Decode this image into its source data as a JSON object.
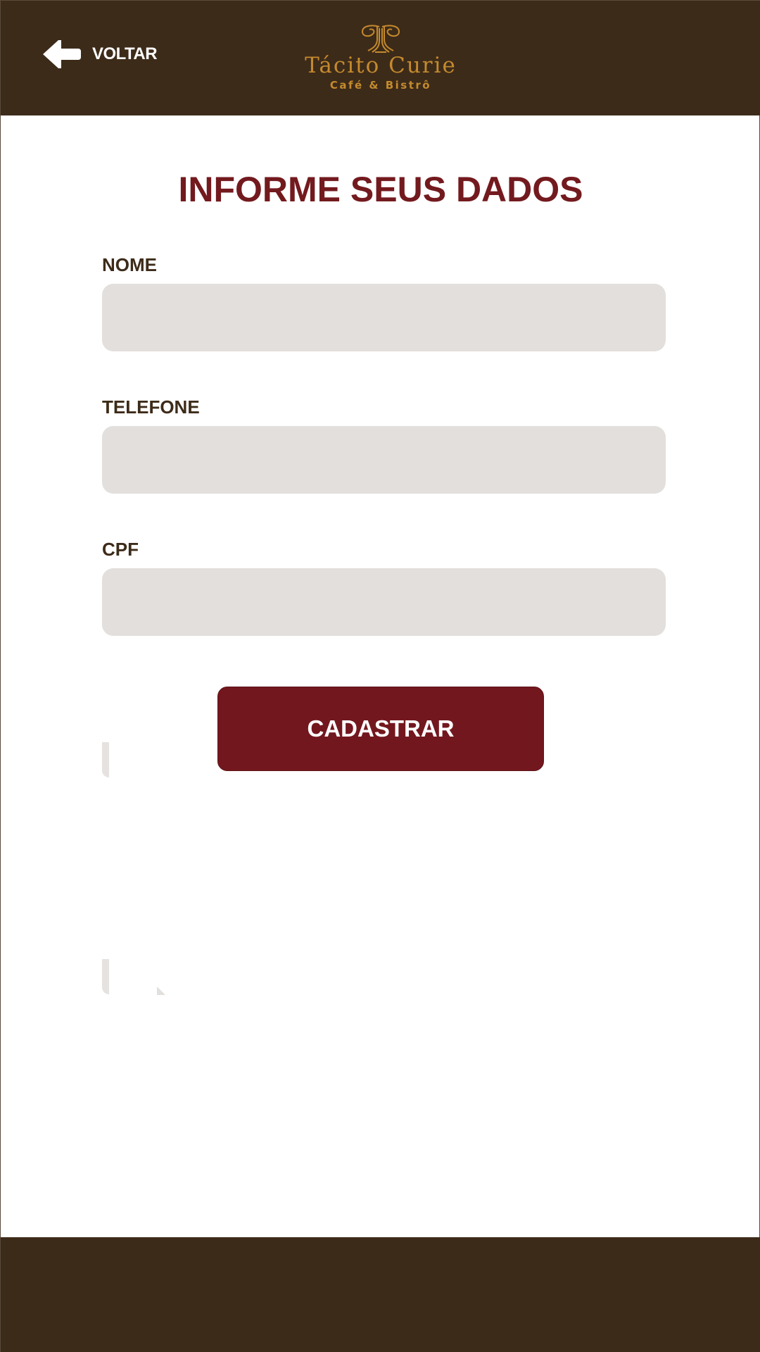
{
  "colors": {
    "header_bg": "#3d2b19",
    "accent": "#731a1e",
    "logo_gold": "#c48a2e",
    "input_bg": "#e2dfdc",
    "label_text": "#3d2b19"
  },
  "header": {
    "back_label": "VOLTAR",
    "back_icon": "arrow-left-icon",
    "logo": {
      "name": "Tácito Curie",
      "subtitle": "Café & Bistrô"
    }
  },
  "main": {
    "title": "INFORME SEUS DADOS",
    "fields": [
      {
        "label": "NOME",
        "value": "",
        "placeholder": ""
      },
      {
        "label": "TELEFONE",
        "value": "",
        "placeholder": ""
      },
      {
        "label": "CPF",
        "value": "",
        "placeholder": ""
      }
    ],
    "submit_label": "CADASTRAR"
  }
}
